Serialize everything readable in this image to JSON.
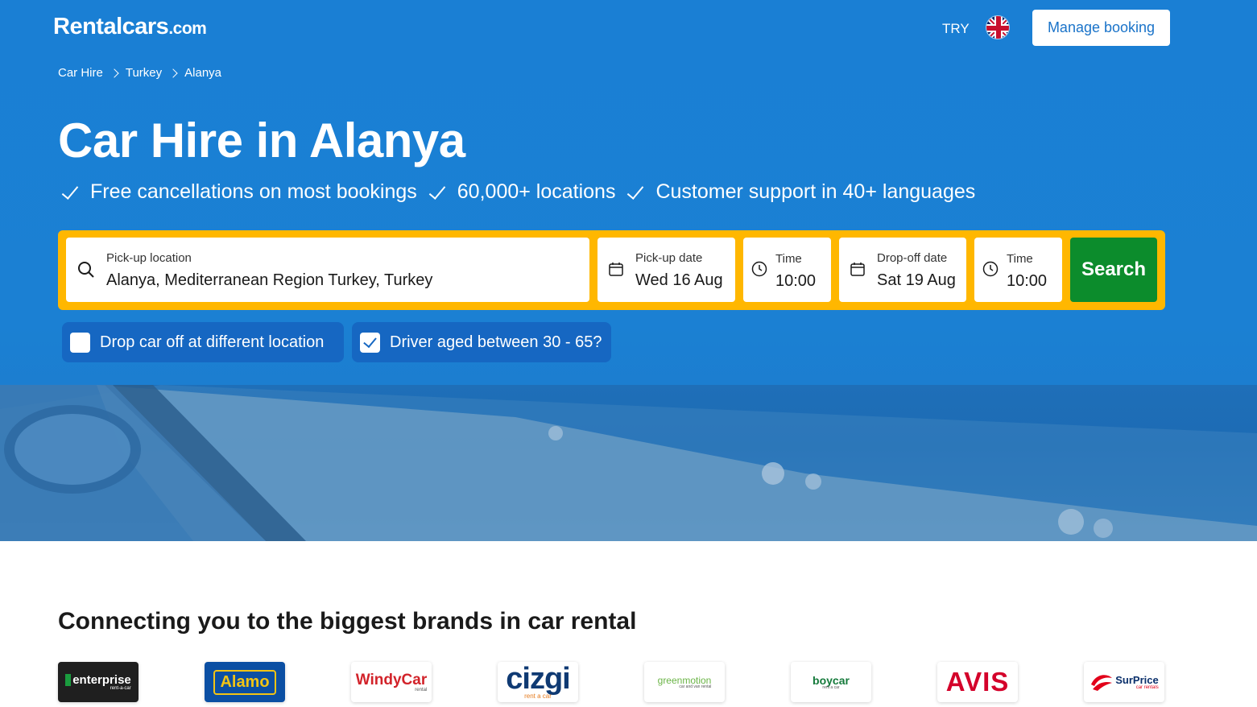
{
  "header": {
    "logo_main": "Rentalcars",
    "logo_suffix": ".com",
    "currency": "TRY",
    "manage_booking_label": "Manage booking"
  },
  "breadcrumb": [
    "Car Hire",
    "Turkey",
    "Alanya"
  ],
  "page_title": "Car Hire in Alanya",
  "usps": [
    "Free cancellations on most bookings",
    "60,000+ locations",
    "Customer support in 40+ languages"
  ],
  "search": {
    "pickup_location_label": "Pick-up location",
    "pickup_location_value": "Alanya, Mediterranean Region Turkey, Turkey",
    "pickup_date_label": "Pick-up date",
    "pickup_date_value": "Wed 16 Aug",
    "pickup_time_label": "Time",
    "pickup_time_value": "10:00",
    "dropoff_date_label": "Drop-off date",
    "dropoff_date_value": "Sat 19 Aug",
    "dropoff_time_label": "Time",
    "dropoff_time_value": "10:00",
    "search_label": "Search"
  },
  "options": {
    "different_location_label": "Drop car off at different location",
    "different_location_checked": false,
    "driver_age_label": "Driver aged between 30 - 65?",
    "driver_age_checked": true
  },
  "brands": {
    "title": "Connecting you to the biggest brands in car rental",
    "items": [
      {
        "name": "enterprise",
        "sub": "rent-a-car"
      },
      {
        "name": "Alamo"
      },
      {
        "name": "WindyCar",
        "sub": "rental"
      },
      {
        "name": "cizgi",
        "sub": "rent a car"
      },
      {
        "name": "greenmotion",
        "sub": "car and van rental"
      },
      {
        "name": "boycar",
        "sub": "rent a car"
      },
      {
        "name": "AVIS"
      },
      {
        "name": "SurPrice",
        "sub": "car rentals"
      }
    ]
  },
  "colors": {
    "brand_blue": "#1a7fd4",
    "search_border": "#ffb700",
    "search_button": "#0c8c2c",
    "option_bg": "#1667c2"
  }
}
